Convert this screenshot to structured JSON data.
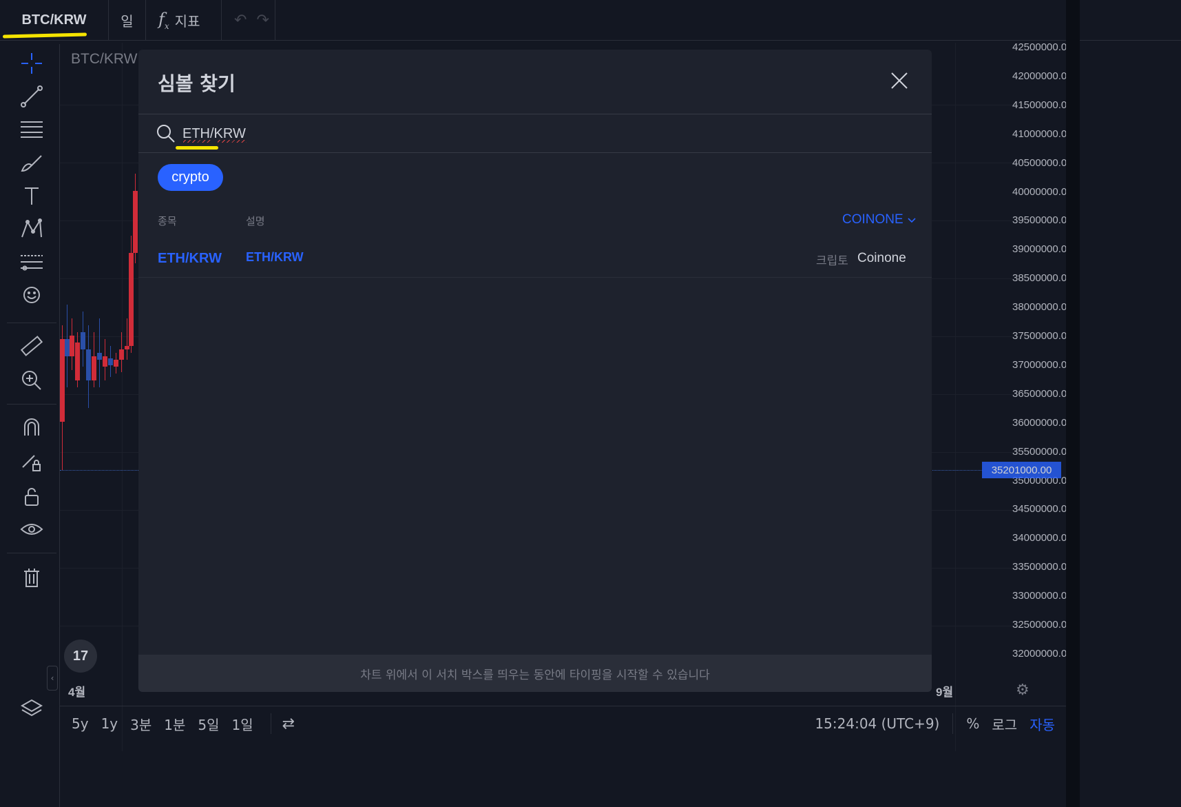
{
  "toolbar": {
    "symbol": "BTC/KRW",
    "interval": "일",
    "indicators_label": "지표"
  },
  "chart": {
    "legend_symbol": "BTC/KRW",
    "current_price": "35201000.00",
    "price_labels": [
      "42500000.00",
      "42000000.00",
      "41500000.00",
      "41000000.00",
      "40500000.00",
      "40000000.00",
      "39500000.00",
      "39000000.00",
      "38500000.00",
      "38000000.00",
      "37500000.00",
      "37000000.00",
      "36500000.00",
      "36000000.00",
      "35500000.00",
      "35000000.00",
      "34500000.00",
      "34000000.00",
      "33500000.00",
      "33000000.00",
      "32500000.00",
      "32000000.00"
    ],
    "time_labels": [
      "4월",
      "9월"
    ],
    "logo_text": "17",
    "colors": {
      "up": "#d12c39",
      "down": "#2a4fa8",
      "accent": "#2962ff"
    }
  },
  "bottom_bar": {
    "ranges": [
      "5y",
      "1y",
      "3분",
      "1분",
      "5일",
      "1일"
    ],
    "clock": "15:24:04 (UTC+9)",
    "percent": "%",
    "log": "로그",
    "auto": "자동"
  },
  "dialog": {
    "title": "심볼 찾기",
    "search_value": "ETH/KRW",
    "filter_chip": "crypto",
    "col_symbol": "종목",
    "col_description": "설명",
    "exchange_filter": "COINONE",
    "results": [
      {
        "symbol": "ETH/KRW",
        "description": "ETH/KRW",
        "type": "크립토",
        "exchange": "Coinone"
      }
    ],
    "footer_hint": "차트 위에서 이 서치 박스를 띄우는 동안에 타이핑을 시작할 수 있습니다"
  }
}
